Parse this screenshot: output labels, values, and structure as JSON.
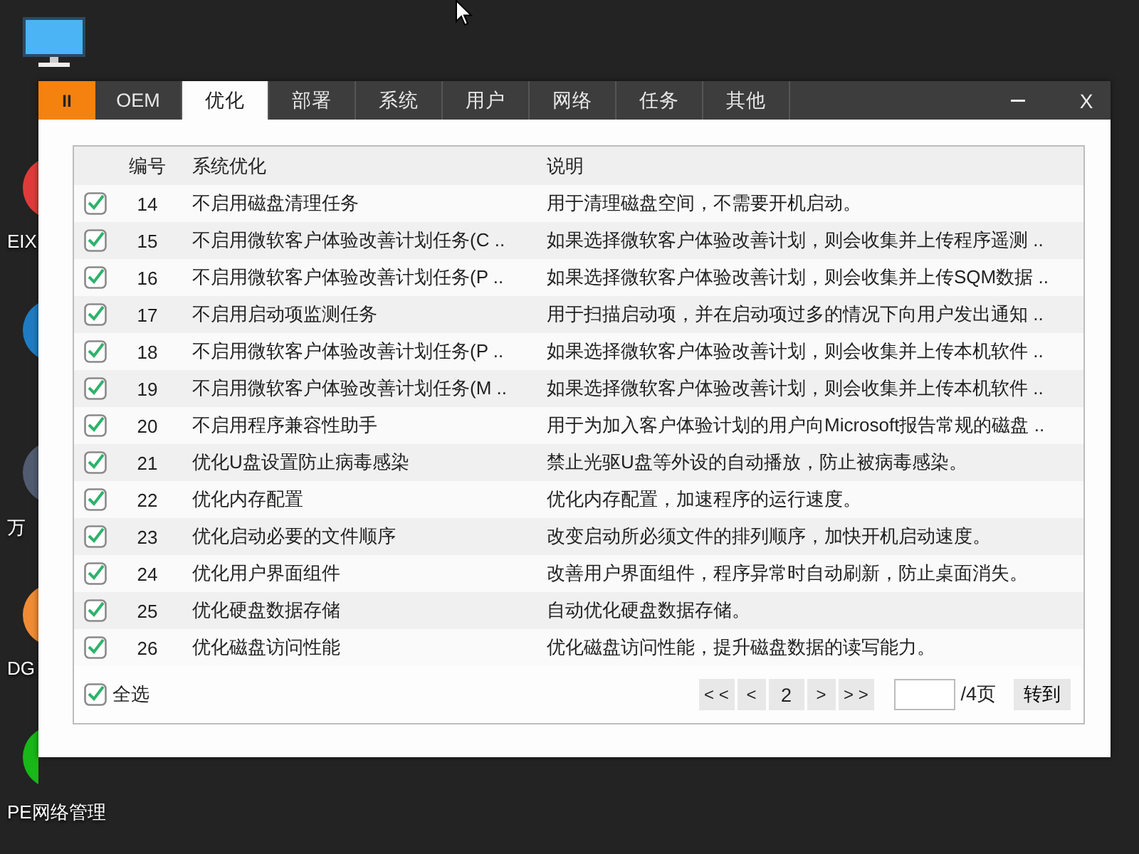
{
  "desktop_icons": [
    {
      "kind": "monitor"
    },
    {
      "kind": "app",
      "color": "#e03b3b",
      "label": "EIX"
    },
    {
      "kind": "app",
      "color": "#1f7cc2"
    },
    {
      "kind": "app",
      "color": "#515c70",
      "label": "万"
    },
    {
      "kind": "app",
      "color": "#f08c34",
      "label": "DG"
    },
    {
      "kind": "app",
      "color": "#17b817",
      "label": "PE网络管理"
    }
  ],
  "window": {
    "pause_button": "II",
    "tabs": [
      {
        "label": "OEM",
        "selected": false
      },
      {
        "label": "优化",
        "selected": true
      },
      {
        "label": "部署",
        "selected": false
      },
      {
        "label": "系统",
        "selected": false
      },
      {
        "label": "用户",
        "selected": false
      },
      {
        "label": "网络",
        "selected": false
      },
      {
        "label": "任务",
        "selected": false
      },
      {
        "label": "其他",
        "selected": false
      }
    ],
    "close_button": "X"
  },
  "table": {
    "columns": [
      "编号",
      "系统优化",
      "说明"
    ],
    "rows": [
      {
        "checked": true,
        "number": "14",
        "name": "不启用磁盘清理任务",
        "description": "用于清理磁盘空间，不需要开机启动。"
      },
      {
        "checked": true,
        "number": "15",
        "name": "不启用微软客户体验改善计划任务(C ..",
        "description": "如果选择微软客户体验改善计划，则会收集并上传程序遥测 .."
      },
      {
        "checked": true,
        "number": "16",
        "name": "不启用微软客户体验改善计划任务(P ..",
        "description": "如果选择微软客户体验改善计划，则会收集并上传SQM数据 .."
      },
      {
        "checked": true,
        "number": "17",
        "name": "不启用启动项监测任务",
        "description": "用于扫描启动项，并在启动项过多的情况下向用户发出通知 .."
      },
      {
        "checked": true,
        "number": "18",
        "name": "不启用微软客户体验改善计划任务(P ..",
        "description": "如果选择微软客户体验改善计划，则会收集并上传本机软件 .."
      },
      {
        "checked": true,
        "number": "19",
        "name": "不启用微软客户体验改善计划任务(M ..",
        "description": "如果选择微软客户体验改善计划，则会收集并上传本机软件 .."
      },
      {
        "checked": true,
        "number": "20",
        "name": "不启用程序兼容性助手",
        "description": "用于为加入客户体验计划的用户向Microsoft报告常规的磁盘 .."
      },
      {
        "checked": true,
        "number": "21",
        "name": "优化U盘设置防止病毒感染",
        "description": "禁止光驱U盘等外设的自动播放，防止被病毒感染。"
      },
      {
        "checked": true,
        "number": "22",
        "name": "优化内存配置",
        "description": "优化内存配置，加速程序的运行速度。"
      },
      {
        "checked": true,
        "number": "23",
        "name": "优化启动必要的文件顺序",
        "description": "改变启动所必须文件的排列顺序，加快开机启动速度。"
      },
      {
        "checked": true,
        "number": "24",
        "name": "优化用户界面组件",
        "description": "改善用户界面组件，程序异常时自动刷新，防止桌面消失。"
      },
      {
        "checked": true,
        "number": "25",
        "name": "优化硬盘数据存储",
        "description": "自动优化硬盘数据存储。"
      },
      {
        "checked": true,
        "number": "26",
        "name": "优化磁盘访问性能",
        "description": "优化磁盘访问性能，提升磁盘数据的读写能力。"
      }
    ]
  },
  "footer": {
    "select_all": {
      "label": "全选",
      "checked": true
    },
    "pagination": {
      "first": "< <",
      "previous": "<",
      "page": "2",
      "next": ">",
      "last": "> >",
      "total": "/4页",
      "go": "转到"
    }
  }
}
